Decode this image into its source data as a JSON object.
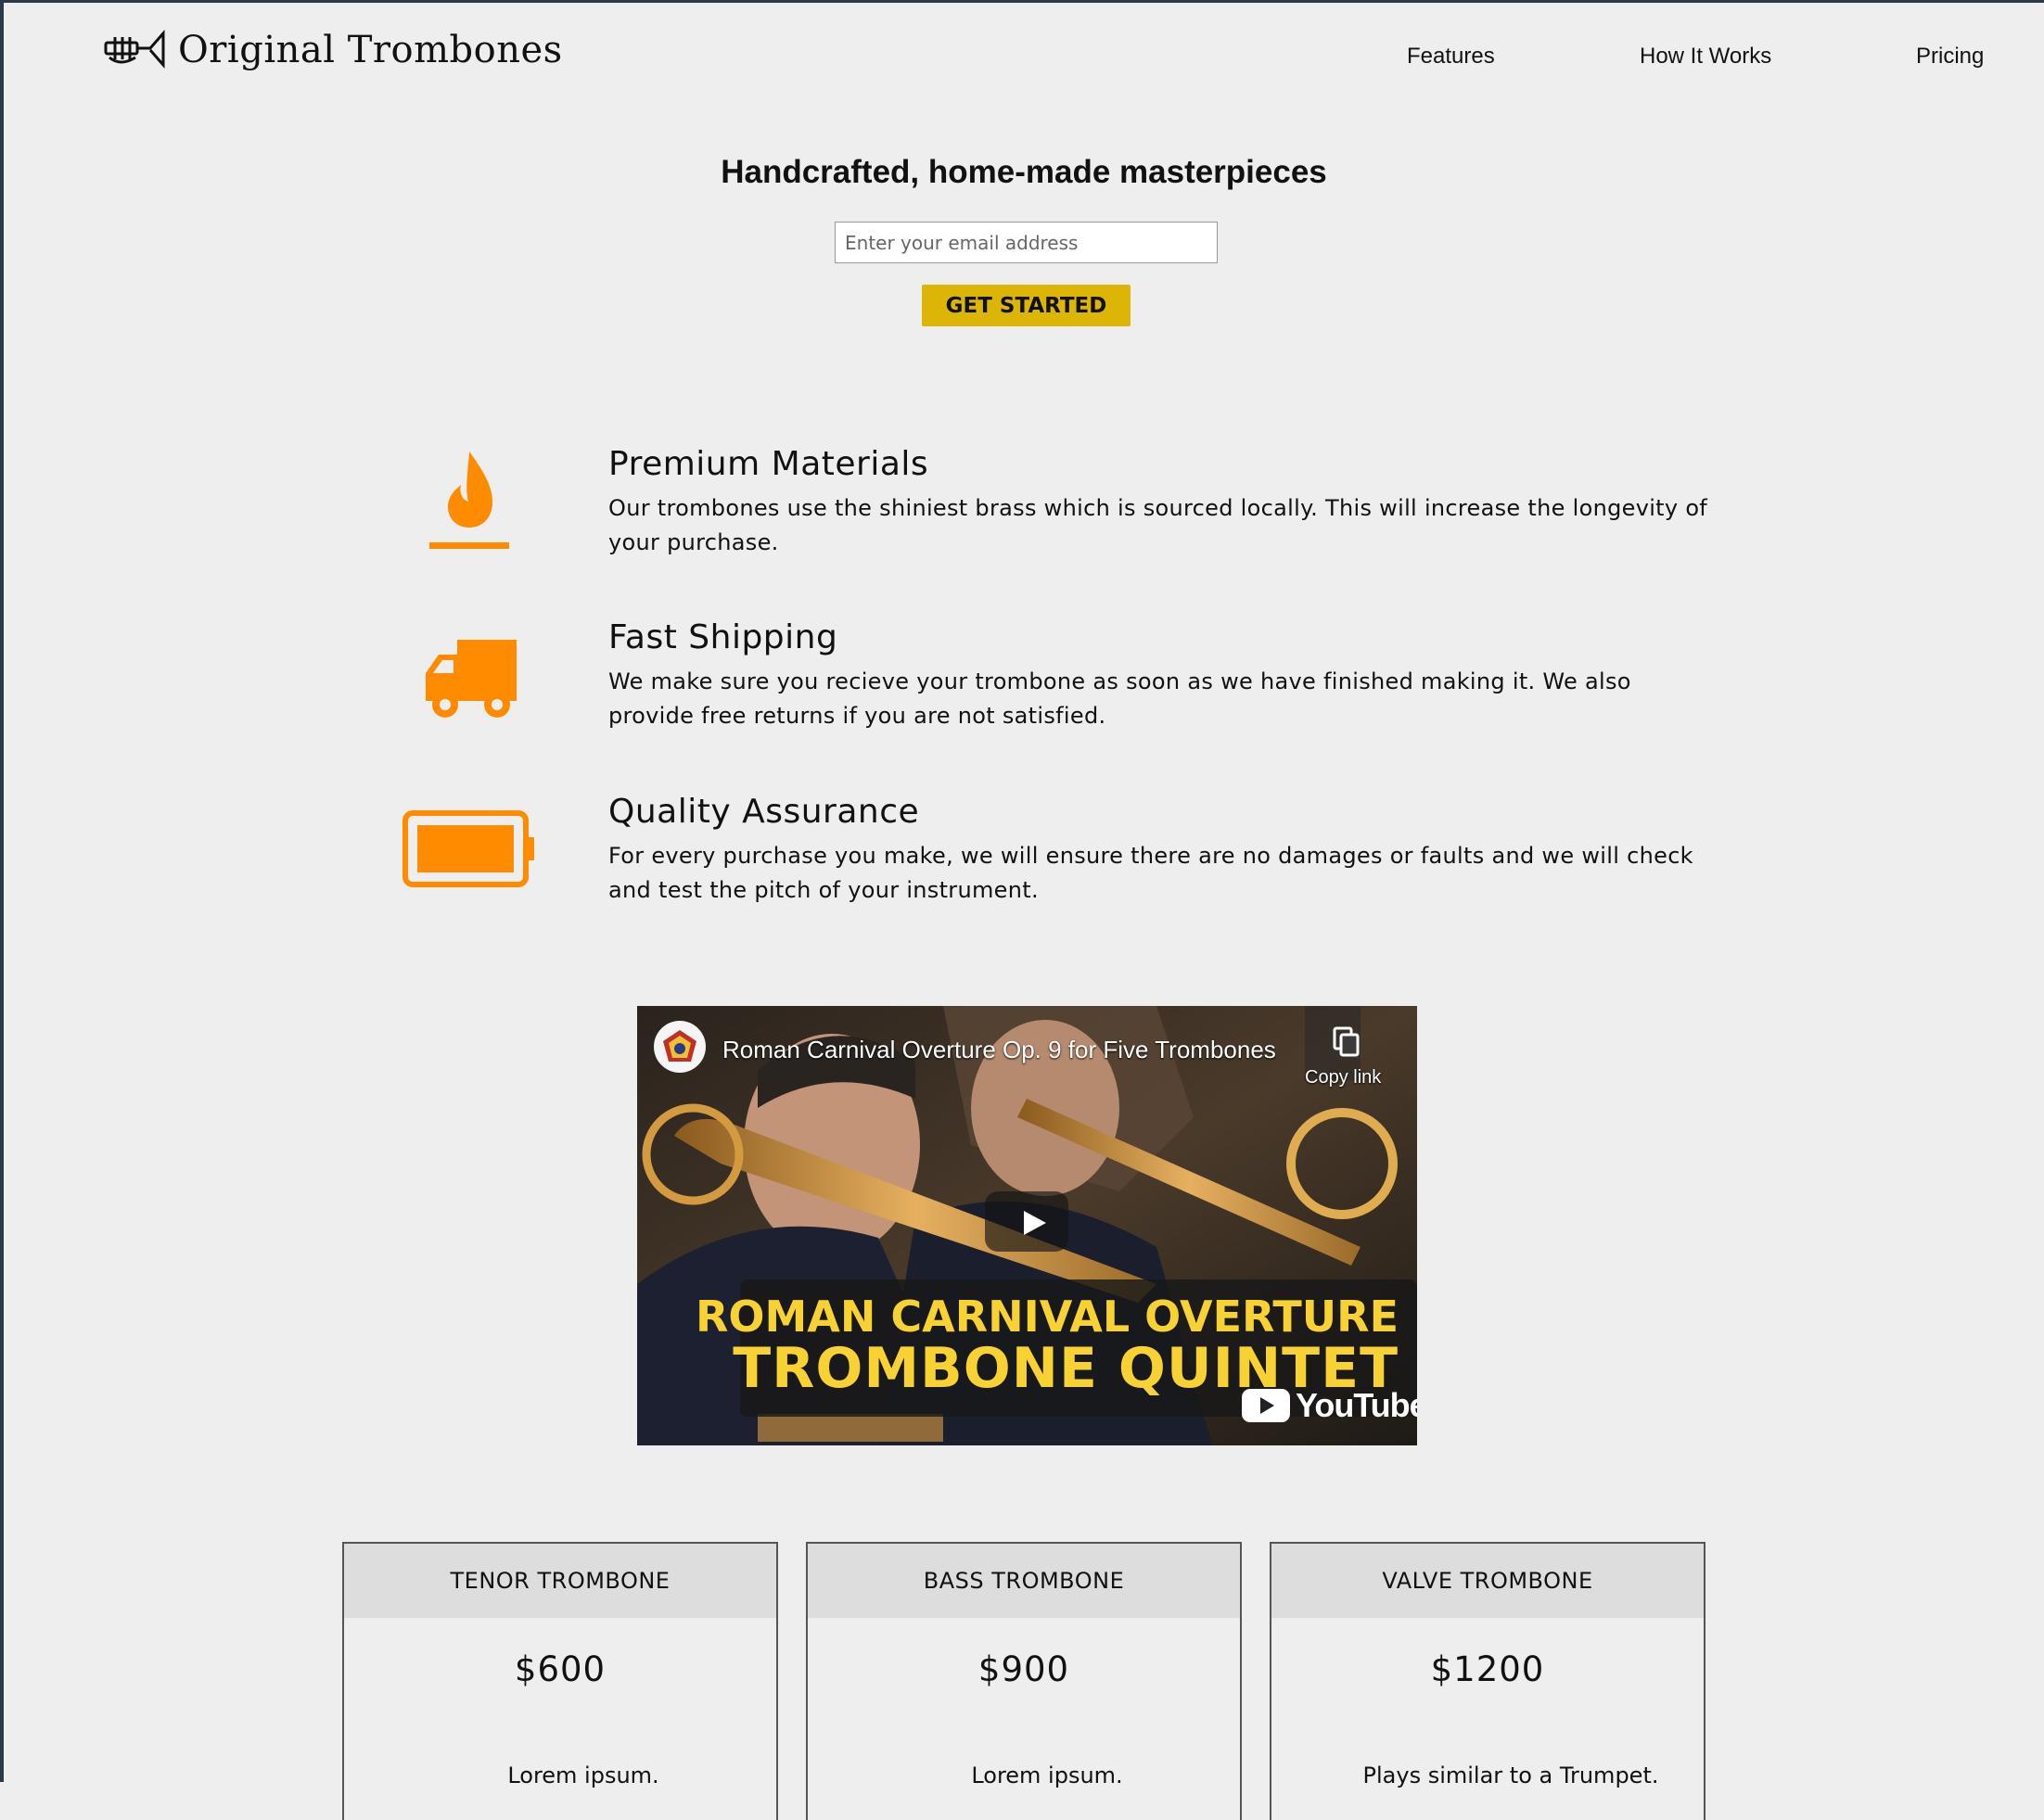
{
  "brand": {
    "name": "Original Trombones",
    "logo_icon": "trumpet-icon"
  },
  "nav": {
    "items": [
      "Features",
      "How It Works",
      "Pricing"
    ]
  },
  "hero": {
    "title": "Handcrafted, home-made masterpieces",
    "email_placeholder": "Enter your email address",
    "cta_label": "GET STARTED"
  },
  "features": [
    {
      "icon": "fire-icon",
      "title": "Premium Materials",
      "description": "Our trombones use the shiniest brass which is sourced locally. This will increase the longevity of your purchase."
    },
    {
      "icon": "truck-icon",
      "title": "Fast Shipping",
      "description": "We make sure you recieve your trombone as soon as we have finished making it. We also provide free returns if you are not satisfied."
    },
    {
      "icon": "battery-full-icon",
      "title": "Quality Assurance",
      "description": "For every purchase you make, we will ensure there are no damages or faults and we will check and test the pitch of your instrument."
    }
  ],
  "video": {
    "title": "Roman Carnival Overture Op. 9 for Five Trombones",
    "copy_link_label": "Copy link",
    "banner_line1": "ROMAN CARNIVAL OVERTURE",
    "banner_line2": "TROMBONE QUINTET",
    "provider": "YouTube"
  },
  "pricing": [
    {
      "name": "TENOR TROMBONE",
      "price": "$600",
      "description": "Lorem ipsum."
    },
    {
      "name": "BASS TROMBONE",
      "price": "$900",
      "description": "Lorem ipsum."
    },
    {
      "name": "VALVE TROMBONE",
      "price": "$1200",
      "description": "Plays similar to a Trumpet."
    }
  ],
  "colors": {
    "accent_orange": "#ff8c00",
    "cta_yellow": "#ddb506",
    "background": "#eeeeee",
    "banner_text": "#f7d232"
  }
}
